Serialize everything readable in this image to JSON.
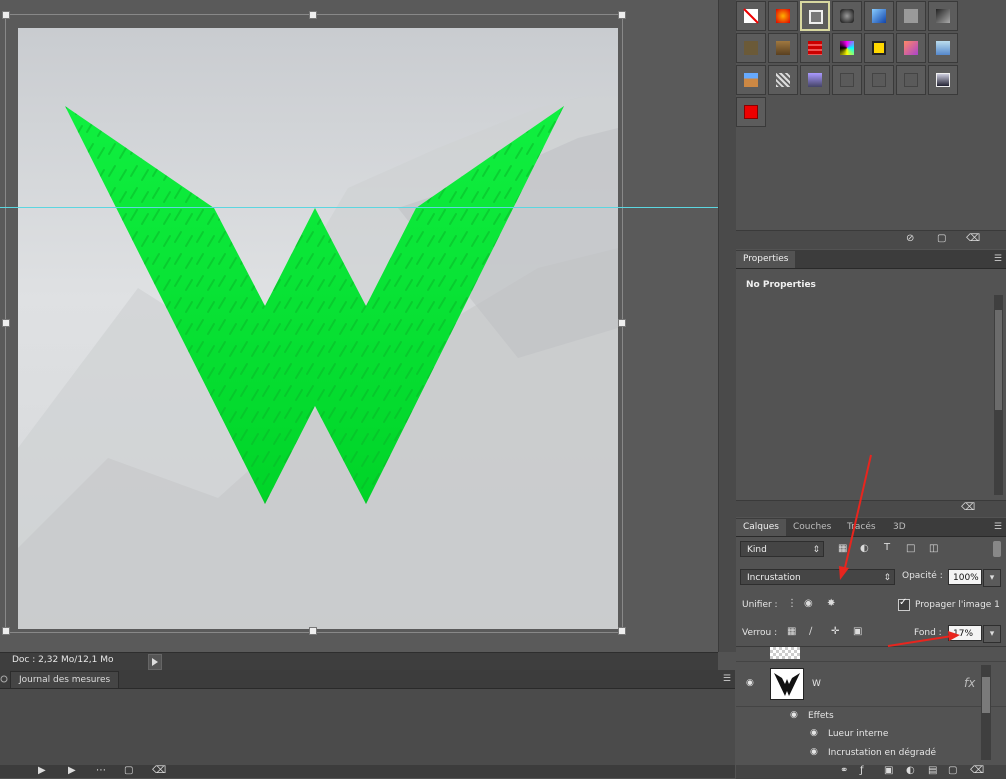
{
  "status_bar": {
    "doc_info": "Doc : 2,32 Mo/12,1 Mo"
  },
  "journal": {
    "tab_label": "Journal des mesures"
  },
  "properties": {
    "tab_label": "Properties",
    "body_text": "No Properties"
  },
  "layers": {
    "tabs": [
      "Calques",
      "Couches",
      "Tracés",
      "3D"
    ],
    "kind_filter": "Kind",
    "blend_mode": "Incrustation",
    "opacity_label": "Opacité :",
    "opacity_value": "100%",
    "unify_label": "Unifier :",
    "propagate_label": "Propager l'image 1",
    "lock_label": "Verrou :",
    "fill_label": "Fond :",
    "fill_value": "17%",
    "layer_name": "W",
    "fx_label": "fx",
    "effects_label": "Effets",
    "effects": [
      "Lueur interne",
      "Incrustation en dégradé"
    ]
  },
  "colors": {
    "logo_green": "#00e830",
    "guide": "#5cd6e0",
    "annotation_red": "#e8251e"
  }
}
